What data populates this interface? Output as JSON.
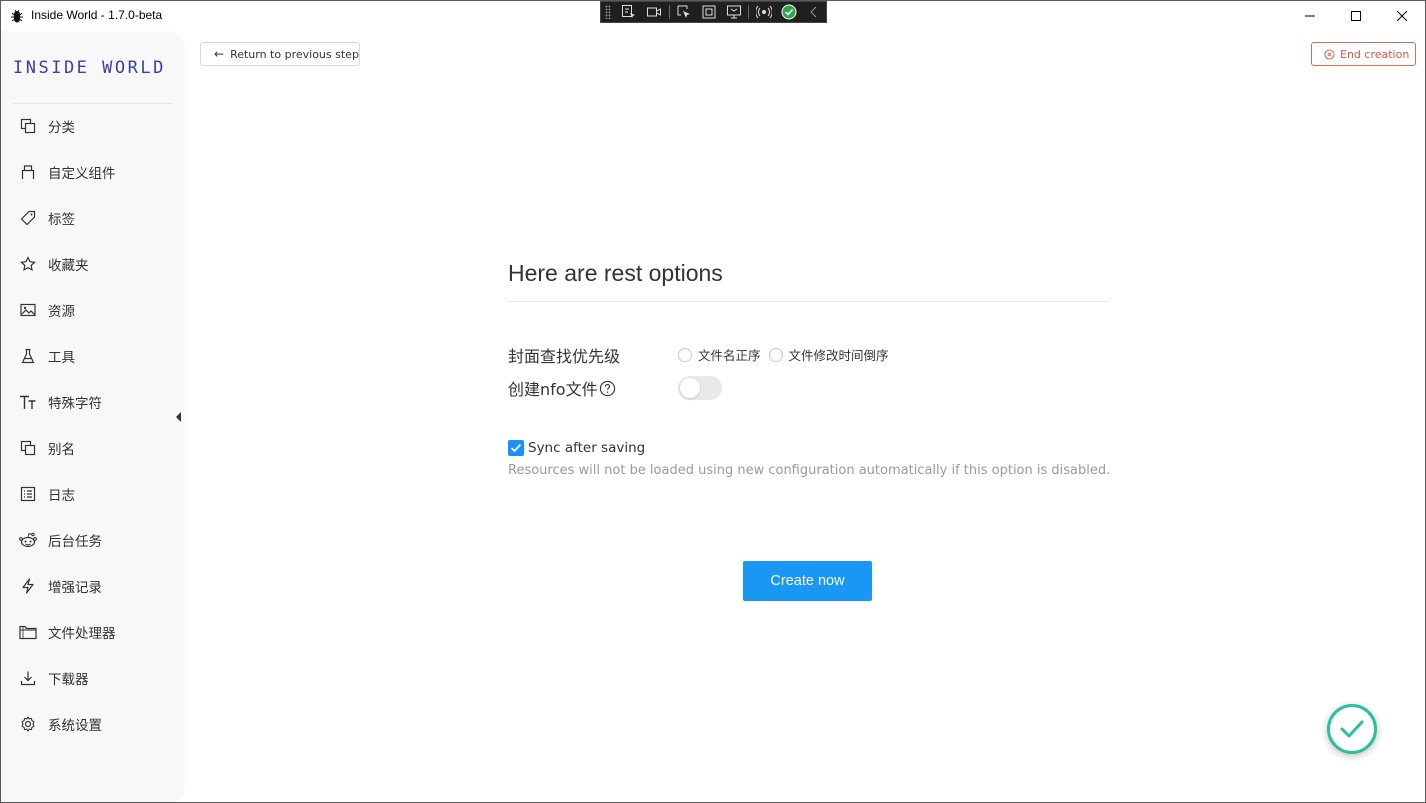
{
  "window": {
    "title": "Inside World - 1.7.0-beta",
    "icon": "bug-icon"
  },
  "debug_toolbar": {
    "icons": [
      "select-element-icon",
      "video-icon",
      "pointer-icon",
      "frame-icon",
      "layout-icon",
      "hot-reload-icon",
      "check-circle-icon",
      "chevron-left-icon"
    ]
  },
  "sidebar": {
    "brand": "INSIDE WORLD",
    "items": [
      {
        "label": "分类",
        "icon": "copy-icon"
      },
      {
        "label": "自定义组件",
        "icon": "component-icon"
      },
      {
        "label": "标签",
        "icon": "tags-icon"
      },
      {
        "label": "收藏夹",
        "icon": "star-icon"
      },
      {
        "label": "资源",
        "icon": "image-icon"
      },
      {
        "label": "工具",
        "icon": "flask-icon"
      },
      {
        "label": "特殊字符",
        "icon": "font-size-icon"
      },
      {
        "label": "别名",
        "icon": "copy-icon"
      },
      {
        "label": "日志",
        "icon": "list-icon"
      },
      {
        "label": "后台任务",
        "icon": "reddit-icon"
      },
      {
        "label": "增强记录",
        "icon": "thunder-icon"
      },
      {
        "label": "文件处理器",
        "icon": "folder-icon"
      },
      {
        "label": "下载器",
        "icon": "download-icon"
      },
      {
        "label": "系统设置",
        "icon": "gear-icon"
      }
    ]
  },
  "toolbar": {
    "back_label": "Return to previous step",
    "end_label": "End creation"
  },
  "main": {
    "title": "Here are rest options",
    "cover_priority": {
      "label": "封面查找优先级",
      "options": [
        "文件名正序",
        "文件修改时间倒序"
      ]
    },
    "nfo": {
      "label": "创建nfo文件",
      "enabled": false
    },
    "sync": {
      "label": "Sync after saving",
      "checked": true,
      "hint": "Resources will not be loaded using new configuration automatically if this option is disabled."
    },
    "create_label": "Create now"
  },
  "colors": {
    "primary": "#1a97f5",
    "danger": "#e0573f",
    "success": "#2bbf9e",
    "brand": "#3a3fa8"
  }
}
